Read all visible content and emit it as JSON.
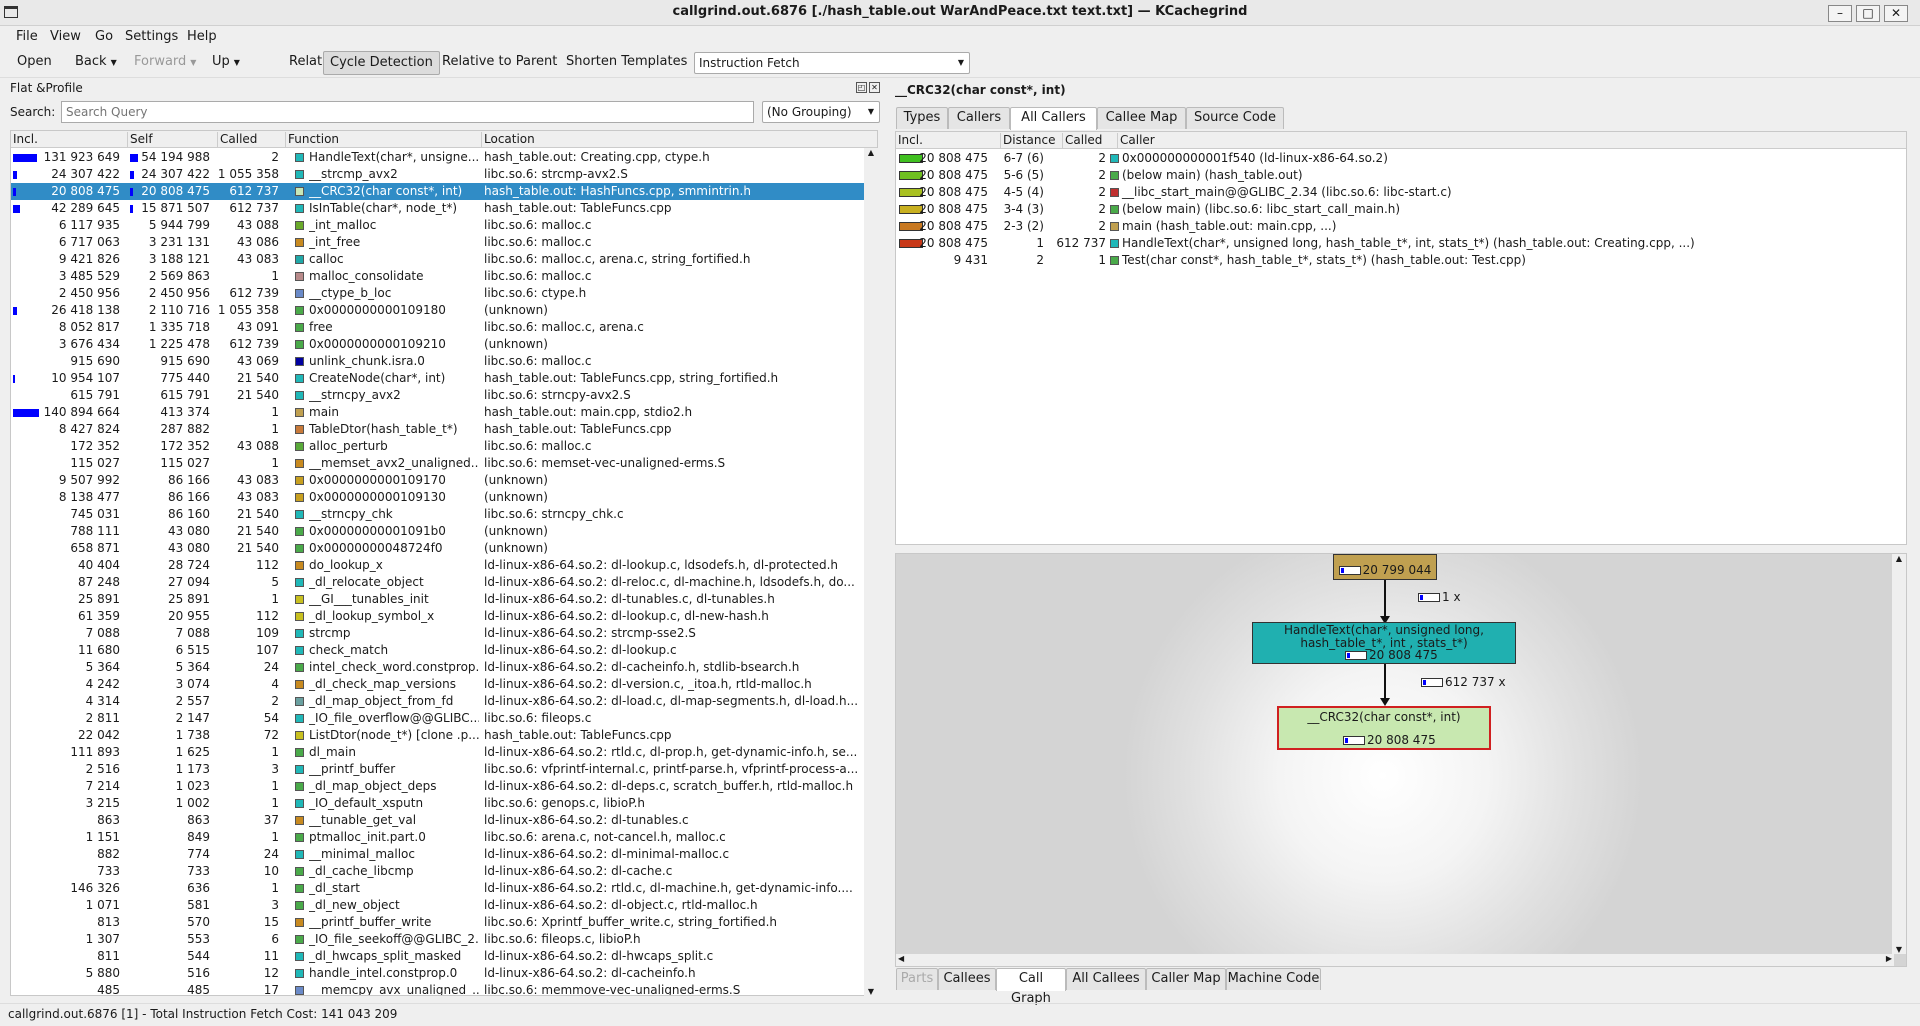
{
  "window": {
    "title": "callgrind.out.6876 [./hash_table.out WarAndPeace.txt text.txt] — KCachegrind"
  },
  "menu": [
    "File",
    "View",
    "Go",
    "Settings",
    "Help"
  ],
  "toolbar": {
    "open": "Open",
    "back": "Back",
    "forward": "Forward",
    "up": "Up",
    "relative": "Relative",
    "cycle": "Cycle Detection",
    "relparent": "Relative to Parent",
    "shorten": "Shorten Templates",
    "event": "Instruction Fetch"
  },
  "flat": {
    "title": "Flat &Profile",
    "search_label": "Search:",
    "search_placeholder": "Search Query",
    "grouping": "(No Grouping)",
    "columns": [
      "Incl.",
      "Self",
      "Called",
      "Function",
      "Location"
    ],
    "rows": [
      {
        "incl": "131 923 649",
        "self": "54 194 988",
        "called": "2",
        "func": "HandleText(char*, unsigne...",
        "loc": "hash_table.out: Creating.cpp, ctype.h",
        "color": "#20b8b8",
        "ib": 24,
        "sb": 8
      },
      {
        "incl": "24 307 422",
        "self": "24 307 422",
        "called": "1 055 358",
        "func": "__strcmp_avx2",
        "loc": "libc.so.6: strcmp-avx2.S",
        "color": "#20b8b8",
        "ib": 4,
        "sb": 4
      },
      {
        "incl": "20 808 475",
        "self": "20 808 475",
        "called": "612 737",
        "func": "__CRC32(char const*, int)",
        "loc": "hash_table.out: HashFuncs.cpp, smmintrin.h",
        "color": "#c8e8b8",
        "ib": 3,
        "sb": 3,
        "sel": true
      },
      {
        "incl": "42 289 645",
        "self": "15 871 507",
        "called": "612 737",
        "func": "IsInTable(char*, node_t*)",
        "loc": "hash_table.out: TableFuncs.cpp",
        "color": "#20b8b8",
        "ib": 7,
        "sb": 3
      },
      {
        "incl": "6 117 935",
        "self": "5 944 799",
        "called": "43 088",
        "func": "_int_malloc",
        "loc": "libc.so.6: malloc.c",
        "color": "#6aaa2a"
      },
      {
        "incl": "6 717 063",
        "self": "3 231 131",
        "called": "43 086",
        "func": "_int_free",
        "loc": "libc.so.6: malloc.c",
        "color": "#c88a20"
      },
      {
        "incl": "9 421 826",
        "self": "3 188 121",
        "called": "43 083",
        "func": "calloc",
        "loc": "libc.so.6: malloc.c, arena.c, string_fortified.h",
        "color": "#20a8a8"
      },
      {
        "incl": "3 485 529",
        "self": "2 569 863",
        "called": "1",
        "func": "malloc_consolidate",
        "loc": "libc.so.6: malloc.c",
        "color": "#b88a8a"
      },
      {
        "incl": "2 450 956",
        "self": "2 450 956",
        "called": "612 739",
        "func": "__ctype_b_loc",
        "loc": "libc.so.6: ctype.h",
        "color": "#6a8ac8"
      },
      {
        "incl": "26 418 138",
        "self": "2 110 716",
        "called": "1 055 358",
        "func": "0x0000000000109180",
        "loc": "(unknown)",
        "color": "#4aaa4a",
        "ib": 4
      },
      {
        "incl": "8 052 817",
        "self": "1 335 718",
        "called": "43 091",
        "func": "free",
        "loc": "libc.so.6: malloc.c, arena.c",
        "color": "#4aaa4a"
      },
      {
        "incl": "3 676 434",
        "self": "1 225 478",
        "called": "612 739",
        "func": "0x0000000000109210",
        "loc": "(unknown)",
        "color": "#4aaa4a"
      },
      {
        "incl": "915 690",
        "self": "915 690",
        "called": "43 069",
        "func": "unlink_chunk.isra.0",
        "loc": "libc.so.6: malloc.c",
        "color": "#0000a0"
      },
      {
        "incl": "10 954 107",
        "self": "775 440",
        "called": "21 540",
        "func": "CreateNode(char*, int)",
        "loc": "hash_table.out: TableFuncs.cpp, string_fortified.h",
        "color": "#20b8b8",
        "ib": 2
      },
      {
        "incl": "615 791",
        "self": "615 791",
        "called": "21 540",
        "func": "__strncpy_avx2",
        "loc": "libc.so.6: strncpy-avx2.S",
        "color": "#20b8b8"
      },
      {
        "incl": "140 894 664",
        "self": "413 374",
        "called": "1",
        "func": "main",
        "loc": "hash_table.out: main.cpp, stdio2.h",
        "color": "#c0a050",
        "ib": 26
      },
      {
        "incl": "8 427 824",
        "self": "287 882",
        "called": "1",
        "func": "TableDtor(hash_table_t*)",
        "loc": "hash_table.out: TableFuncs.cpp",
        "color": "#c87a3a"
      },
      {
        "incl": "172 352",
        "self": "172 352",
        "called": "43 088",
        "func": "alloc_perturb",
        "loc": "libc.so.6: malloc.c",
        "color": "#5aaa3a"
      },
      {
        "incl": "115 027",
        "self": "115 027",
        "called": "1",
        "func": "__memset_avx2_unaligned...",
        "loc": "libc.so.6: memset-vec-unaligned-erms.S",
        "color": "#c88a20"
      },
      {
        "incl": "9 507 992",
        "self": "86 166",
        "called": "43 083",
        "func": "0x0000000000109170",
        "loc": "(unknown)",
        "color": "#c8a020"
      },
      {
        "incl": "8 138 477",
        "self": "86 166",
        "called": "43 083",
        "func": "0x0000000000109130",
        "loc": "(unknown)",
        "color": "#c8a020"
      },
      {
        "incl": "745 031",
        "self": "86 160",
        "called": "21 540",
        "func": "__strncpy_chk",
        "loc": "libc.so.6: strncpy_chk.c",
        "color": "#20b8b8"
      },
      {
        "incl": "788 111",
        "self": "43 080",
        "called": "21 540",
        "func": "0x00000000001091b0",
        "loc": "(unknown)",
        "color": "#4aaa4a"
      },
      {
        "incl": "658 871",
        "self": "43 080",
        "called": "21 540",
        "func": "0x00000000048724f0",
        "loc": "(unknown)",
        "color": "#4aaa4a"
      },
      {
        "incl": "40 404",
        "self": "28 724",
        "called": "112",
        "func": "do_lookup_x",
        "loc": "ld-linux-x86-64.so.2: dl-lookup.c, ldsodefs.h, dl-protected.h",
        "color": "#c88a20"
      },
      {
        "incl": "87 248",
        "self": "27 094",
        "called": "5",
        "func": "_dl_relocate_object",
        "loc": "ld-linux-x86-64.so.2: dl-reloc.c, dl-machine.h, ldsodefs.h, do...",
        "color": "#20b8b8"
      },
      {
        "incl": "25 891",
        "self": "25 891",
        "called": "1",
        "func": "__GI___tunables_init",
        "loc": "ld-linux-x86-64.so.2: dl-tunables.c, dl-tunables.h",
        "color": "#c8c020"
      },
      {
        "incl": "61 359",
        "self": "20 955",
        "called": "112",
        "func": "_dl_lookup_symbol_x",
        "loc": "ld-linux-x86-64.so.2: dl-lookup.c, dl-new-hash.h",
        "color": "#c8c020"
      },
      {
        "incl": "7 088",
        "self": "7 088",
        "called": "109",
        "func": "strcmp",
        "loc": "ld-linux-x86-64.so.2: strcmp-sse2.S",
        "color": "#20b8b8"
      },
      {
        "incl": "11 680",
        "self": "6 515",
        "called": "107",
        "func": "check_match",
        "loc": "ld-linux-x86-64.so.2: dl-lookup.c",
        "color": "#20b8b8"
      },
      {
        "incl": "5 364",
        "self": "5 364",
        "called": "24",
        "func": "intel_check_word.constprop.0",
        "loc": "ld-linux-x86-64.so.2: dl-cacheinfo.h, stdlib-bsearch.h",
        "color": "#4aaa4a"
      },
      {
        "incl": "4 242",
        "self": "3 074",
        "called": "4",
        "func": "_dl_check_map_versions",
        "loc": "ld-linux-x86-64.so.2: dl-version.c, _itoa.h, rtld-malloc.h",
        "color": "#c88a20"
      },
      {
        "incl": "4 314",
        "self": "2 557",
        "called": "2",
        "func": "_dl_map_object_from_fd",
        "loc": "ld-linux-x86-64.so.2: dl-load.c, dl-map-segments.h, dl-load.h...",
        "color": "#6aa0a0"
      },
      {
        "incl": "2 811",
        "self": "2 147",
        "called": "54",
        "func": "_IO_file_overflow@@GLIBC...",
        "loc": "libc.so.6: fileops.c",
        "color": "#20b8b8"
      },
      {
        "incl": "22 042",
        "self": "1 738",
        "called": "72",
        "func": "ListDtor(node_t*) [clone .p...",
        "loc": "hash_table.out: TableFuncs.cpp",
        "color": "#c8c020"
      },
      {
        "incl": "111 893",
        "self": "1 625",
        "called": "1",
        "func": "dl_main",
        "loc": "ld-linux-x86-64.so.2: rtld.c, dl-prop.h, get-dynamic-info.h, se...",
        "color": "#4aaa4a"
      },
      {
        "incl": "2 516",
        "self": "1 173",
        "called": "3",
        "func": "__printf_buffer",
        "loc": "libc.so.6: vfprintf-internal.c, printf-parse.h, vfprintf-process-a...",
        "color": "#20b8b8"
      },
      {
        "incl": "7 214",
        "self": "1 023",
        "called": "1",
        "func": "_dl_map_object_deps",
        "loc": "ld-linux-x86-64.so.2: dl-deps.c, scratch_buffer.h, rtld-malloc.h",
        "color": "#4aaa4a"
      },
      {
        "incl": "3 215",
        "self": "1 002",
        "called": "1",
        "func": "_IO_default_xsputn",
        "loc": "libc.so.6: genops.c, libioP.h",
        "color": "#20b8b8"
      },
      {
        "incl": "863",
        "self": "863",
        "called": "37",
        "func": "__tunable_get_val",
        "loc": "ld-linux-x86-64.so.2: dl-tunables.c",
        "color": "#c88a20"
      },
      {
        "incl": "1 151",
        "self": "849",
        "called": "1",
        "func": "ptmalloc_init.part.0",
        "loc": "libc.so.6: arena.c, not-cancel.h, malloc.c",
        "color": "#4aaa4a"
      },
      {
        "incl": "882",
        "self": "774",
        "called": "24",
        "func": "__minimal_malloc",
        "loc": "ld-linux-x86-64.so.2: dl-minimal-malloc.c",
        "color": "#20b8b8"
      },
      {
        "incl": "733",
        "self": "733",
        "called": "10",
        "func": "_dl_cache_libcmp",
        "loc": "ld-linux-x86-64.so.2: dl-cache.c",
        "color": "#4aaa4a"
      },
      {
        "incl": "146 326",
        "self": "636",
        "called": "1",
        "func": "_dl_start",
        "loc": "ld-linux-x86-64.so.2: rtld.c, dl-machine.h, get-dynamic-info....",
        "color": "#4aaa4a"
      },
      {
        "incl": "1 071",
        "self": "581",
        "called": "3",
        "func": "_dl_new_object",
        "loc": "ld-linux-x86-64.so.2: dl-object.c, rtld-malloc.h",
        "color": "#4aaa4a"
      },
      {
        "incl": "813",
        "self": "570",
        "called": "15",
        "func": "__printf_buffer_write",
        "loc": "libc.so.6: Xprintf_buffer_write.c, string_fortified.h",
        "color": "#c88a20"
      },
      {
        "incl": "1 307",
        "self": "553",
        "called": "6",
        "func": "_IO_file_seekoff@@GLIBC_2...",
        "loc": "libc.so.6: fileops.c, libioP.h",
        "color": "#4aaa4a"
      },
      {
        "incl": "811",
        "self": "544",
        "called": "11",
        "func": "_dl_hwcaps_split_masked",
        "loc": "ld-linux-x86-64.so.2: dl-hwcaps_split.c",
        "color": "#20b8b8"
      },
      {
        "incl": "5 880",
        "self": "516",
        "called": "12",
        "func": "handle_intel.constprop.0",
        "loc": "ld-linux-x86-64.so.2: dl-cacheinfo.h",
        "color": "#20b8b8"
      },
      {
        "incl": "485",
        "self": "485",
        "called": "17",
        "func": "__memcpy_avx_unaligned_...",
        "loc": "libc.so.6: memmove-vec-unaligned-erms.S",
        "color": "#6a8ac8"
      }
    ]
  },
  "detail": {
    "title": "__CRC32(char const*, int)",
    "top_tabs": [
      "Types",
      "Callers",
      "All Callers",
      "Callee Map",
      "Source Code"
    ],
    "callers_columns": [
      "Incl.",
      "Distance",
      "Called",
      "Caller"
    ],
    "callers": [
      {
        "incl": "20 808 475",
        "dist": "6-7 (6)",
        "called": "2",
        "caller": "0x000000000001f540 (ld-linux-x86-64.so.2)",
        "bar": "#40c020",
        "sq": "#20b8b8"
      },
      {
        "incl": "20 808 475",
        "dist": "5-6 (5)",
        "called": "2",
        "caller": "(below main) (hash_table.out)",
        "bar": "#70c020",
        "sq": "#4aaa4a"
      },
      {
        "incl": "20 808 475",
        "dist": "4-5 (4)",
        "called": "2",
        "caller": "__libc_start_main@@GLIBC_2.34 (libc.so.6: libc-start.c)",
        "bar": "#a8c020",
        "sq": "#c03030"
      },
      {
        "incl": "20 808 475",
        "dist": "3-4 (3)",
        "called": "2",
        "caller": "(below main) (libc.so.6: libc_start_call_main.h)",
        "bar": "#c8b020",
        "sq": "#4aaa4a"
      },
      {
        "incl": "20 808 475",
        "dist": "2-3 (2)",
        "called": "2",
        "caller": "main (hash_table.out: main.cpp, ...)",
        "bar": "#c87820",
        "sq": "#c0a050"
      },
      {
        "incl": "20 808 475",
        "dist": "1",
        "called": "612 737",
        "caller": "HandleText(char*, unsigned long, hash_table_t*, int, stats_t*) (hash_table.out: Creating.cpp, ...)",
        "bar": "#c83818",
        "sq": "#20b8b8"
      },
      {
        "incl": "9 431",
        "dist": "2",
        "called": "1",
        "caller": "Test(char const*, hash_table_t*, stats_t*) (hash_table.out: Test.cpp)",
        "bar": "",
        "sq": "#4aaa4a"
      }
    ],
    "graph": {
      "top_value": "20 799 044",
      "edge1": "1 x",
      "mid_label": "HandleText(char*, unsigned long, hash_table_t*, int , stats_t*)",
      "mid_value": "20 808 475",
      "edge2": "612 737 x",
      "bottom_label": "__CRC32(char const*, int)",
      "bottom_value": "20 808 475"
    },
    "bottom_tabs": [
      "Parts",
      "Callees",
      "Call Graph",
      "All Callees",
      "Caller Map",
      "Machine Code"
    ]
  },
  "status": "callgrind.out.6876 [1] - Total Instruction Fetch Cost: 141 043 209",
  "colors": {
    "selection": "#308cc6",
    "bar": "#0000ff",
    "graph_top": "#c0a050",
    "graph_mid": "#20b0b0",
    "graph_bottom": "#c8e8b0"
  }
}
